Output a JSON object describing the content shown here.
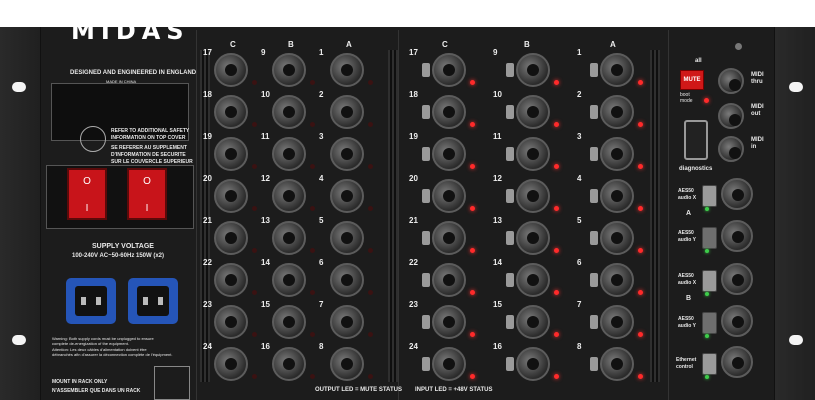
{
  "brand": {
    "logo": "MIDAS",
    "designed": "DESIGNED AND ENGINEERED IN ENGLAND",
    "made": "MADE IN CHINA"
  },
  "safety": {
    "line1": "REFER TO ADDITIONAL SAFETY",
    "line2": "INFORMATION ON TOP COVER",
    "line3": "SE REFERER AU SUPPLEMENT",
    "line4": "D'INFORMATION DE SECURITE",
    "line5": "SUR LE COUVERCLE SUPERIEUR"
  },
  "power": {
    "switch_on": "O",
    "switch_off": "I",
    "supply_title": "SUPPLY VOLTAGE",
    "supply_spec": "100-240V  AC~50-60Hz 150W (x2)",
    "warning1": "Warning: Both supply cords must be unplugged to ensure",
    "warning2": "complete de-energization of the equipment.",
    "warning3": "Attention: Les deux câbles d'alimentation doivent être",
    "warning4": "débranchés afin d'assurer la déconnection complète de l'équipment.",
    "rack1": "MOUNT IN RACK ONLY",
    "rack2": "N'ASSEMBLER QUE DANS UN RACK"
  },
  "groups": {
    "c": "C",
    "b": "B",
    "a": "A"
  },
  "outputs": {
    "c": [
      "17",
      "18",
      "19",
      "20",
      "21",
      "22",
      "23",
      "24"
    ],
    "b": [
      "9",
      "10",
      "11",
      "12",
      "13",
      "14",
      "15",
      "16"
    ],
    "a": [
      "1",
      "2",
      "3",
      "4",
      "5",
      "6",
      "7",
      "8"
    ],
    "status": "OUTPUT LED = MUTE STATUS"
  },
  "inputs": {
    "c": [
      "17",
      "18",
      "19",
      "20",
      "21",
      "22",
      "23",
      "24"
    ],
    "b": [
      "9",
      "10",
      "11",
      "12",
      "13",
      "14",
      "15",
      "16"
    ],
    "a": [
      "1",
      "2",
      "3",
      "4",
      "5",
      "6",
      "7",
      "8"
    ],
    "status": "INPUT LED = +48V STATUS"
  },
  "control": {
    "all_label": "all",
    "mute_button": "MUTE",
    "boot_mode": "boot\nmode",
    "diagnostics": "diagnostics",
    "midi_thru": "MIDI\nthru",
    "midi_out": "MIDI\nout",
    "midi_in": "MIDI\nin",
    "aes50_a": "A",
    "aes50_b": "B",
    "aes50_ax": "AES50\naudio X",
    "aes50_ay": "AES50\naudio Y",
    "aes50_bx": "AES50\naudio X",
    "aes50_by": "AES50\naudio Y",
    "ethernet": "Ethernet\ncontrol"
  },
  "colors": {
    "chassis": "#1c1c1c",
    "switch_red": "#c8141a",
    "iec_blue": "#2555b8",
    "led_red": "#ff2a2a",
    "led_green": "#3dcc4a"
  }
}
